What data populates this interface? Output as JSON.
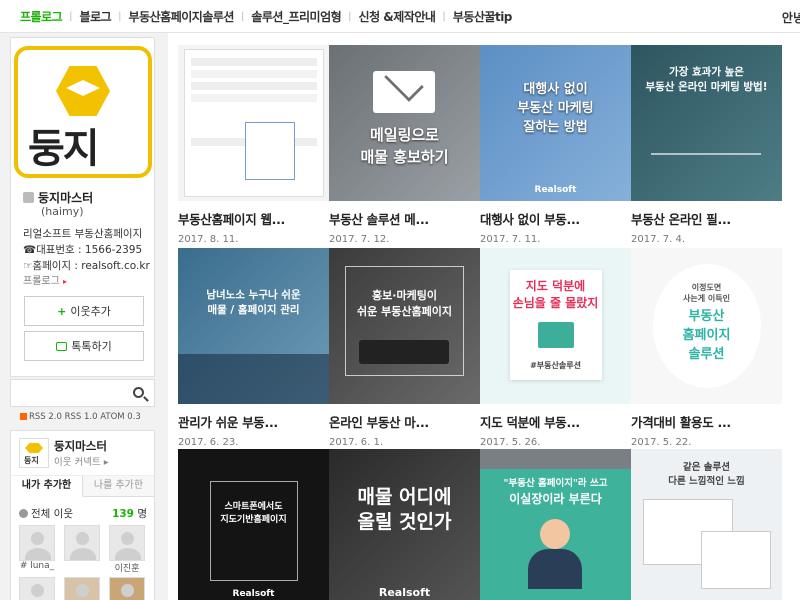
{
  "nav": {
    "items": [
      "프롤로그",
      "블로그",
      "부동산홈페이지솔루션",
      "솔루션_프리미엄형",
      "신청 &제작안내",
      "부동산꿀tip"
    ],
    "right": "안녕"
  },
  "profile": {
    "logo_text": "둥지",
    "name": "둥지마스터",
    "id": "(haimy)",
    "desc": [
      "리얼소프트 부동산홈페이지",
      "☎대표번호 : 1566-2395",
      "☞홈페이지 : realsoft.co.kr"
    ],
    "prolog": "프롤로그",
    "add_neighbor": "이웃추가",
    "talk": "톡톡하기"
  },
  "rss": "RSS 2.0  RSS 1.0  ATOM 0.3",
  "neighbors": {
    "logo_text": "둥지",
    "title": "둥지마스터",
    "sub": "이웃 커넥트",
    "tab_mine": "내가 추가한",
    "tab_theirs": "나를 추가한",
    "all_label": "전체 이웃",
    "count": "139",
    "count_unit": "명",
    "names": [
      "# luna_",
      "",
      "이진훈"
    ]
  },
  "posts": [
    {
      "title": "부동산홈페이지 웹...",
      "date": "2017. 8. 11."
    },
    {
      "title": "부동산 솔루션 메...",
      "date": "2017. 7. 12.",
      "thumb": [
        "메일링으로",
        "매물 홍보하기"
      ]
    },
    {
      "title": "대행사 없이 부동...",
      "date": "2017. 7. 11.",
      "thumb": [
        "대행사 없이",
        "부동산 마케팅",
        "잘하는 방법"
      ],
      "brand": "Realsoft"
    },
    {
      "title": "부동산 온라인 필...",
      "date": "2017. 7. 4.",
      "thumb": [
        "가장 효과가 높은",
        "부동산 온라인 마케팅 방법!"
      ]
    },
    {
      "title": "관리가 쉬운 부동...",
      "date": "2017. 6. 23.",
      "thumb": [
        "남녀노소 누구나 쉬운",
        "매물 / 홈페이지 관리"
      ]
    },
    {
      "title": "온라인 부동산 마...",
      "date": "2017. 6. 1.",
      "thumb": [
        "홍보·마케팅이",
        "쉬운 부동산홈페이지"
      ]
    },
    {
      "title": "지도 덕분에 부동...",
      "date": "2017. 5. 26.",
      "thumb": [
        "지도 덕분에",
        "손님을 줄 몰랐지"
      ],
      "tag": "#부동산솔루션"
    },
    {
      "title": "가격대비 활용도 ...",
      "date": "2017. 5. 22.",
      "thumb": [
        "이정도면",
        "사는게 이득인",
        "부동산",
        "홈페이지",
        "솔루션"
      ]
    },
    {
      "title": "",
      "date": "",
      "thumb": [
        "스마트폰에서도",
        "지도기반홈페이지"
      ],
      "brand": "Realsoft"
    },
    {
      "title": "",
      "date": "",
      "thumb": [
        "매물 어디에",
        "올릴 것인가"
      ],
      "brand": "Realsoft"
    },
    {
      "title": "",
      "date": "",
      "thumb": [
        "\"부동산 홈페이지\"라 쓰고",
        "이실장이라 부른다"
      ]
    },
    {
      "title": "",
      "date": "",
      "thumb": [
        "같은 솔루션",
        "다른 느낌적인 느낌"
      ]
    }
  ]
}
